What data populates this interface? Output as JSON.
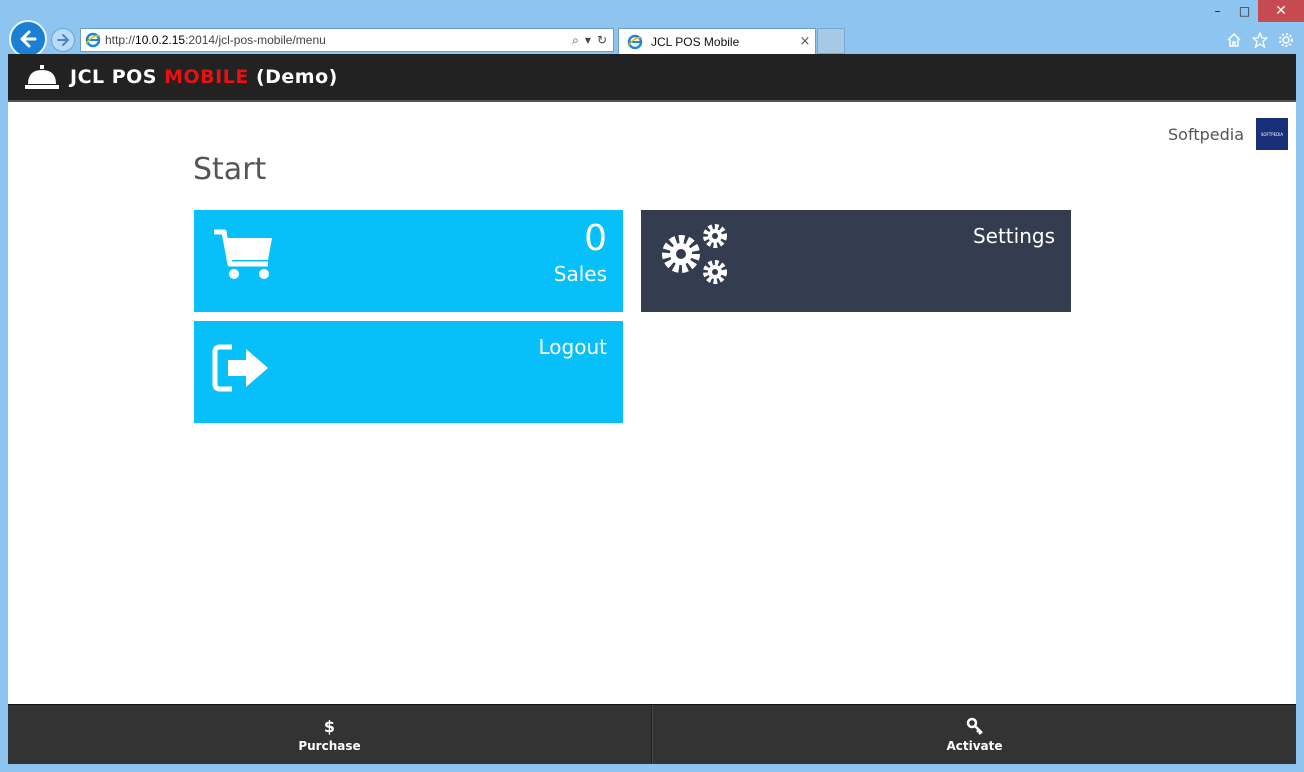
{
  "window": {
    "minimize": "–",
    "maximize": "□",
    "close": "✕"
  },
  "browser": {
    "url_prefix": "http://",
    "url_host": "10.0.2.15",
    "url_path": ":2014/jcl-pos-mobile/menu",
    "tab_title": "JCL POS Mobile",
    "tab_close": "×",
    "search_icon": "⌕",
    "dropdown_icon": "▾",
    "refresh_icon": "↻",
    "tools": [
      "home-icon",
      "star-icon",
      "gear-icon"
    ]
  },
  "app": {
    "title_part1": "JCL POS ",
    "title_part2": "MOBILE",
    "title_part3": " (Demo)",
    "accent_red": "#e81010"
  },
  "user": {
    "name": "Softpedia",
    "avatar_text": "SOFTPEDIA"
  },
  "page": {
    "title": "Start"
  },
  "tiles": {
    "sales": {
      "count": "0",
      "label": "Sales",
      "icon": "cart-icon",
      "color": "#08c0f9"
    },
    "settings": {
      "label": "Settings",
      "icon": "gears-icon",
      "color": "#333d4f"
    },
    "logout": {
      "label": "Logout",
      "icon": "logout-icon",
      "color": "#08c0f9"
    }
  },
  "footer": {
    "purchase": {
      "icon": "$",
      "label": "Purchase"
    },
    "activate": {
      "icon": "key-icon",
      "label": "Activate"
    }
  }
}
